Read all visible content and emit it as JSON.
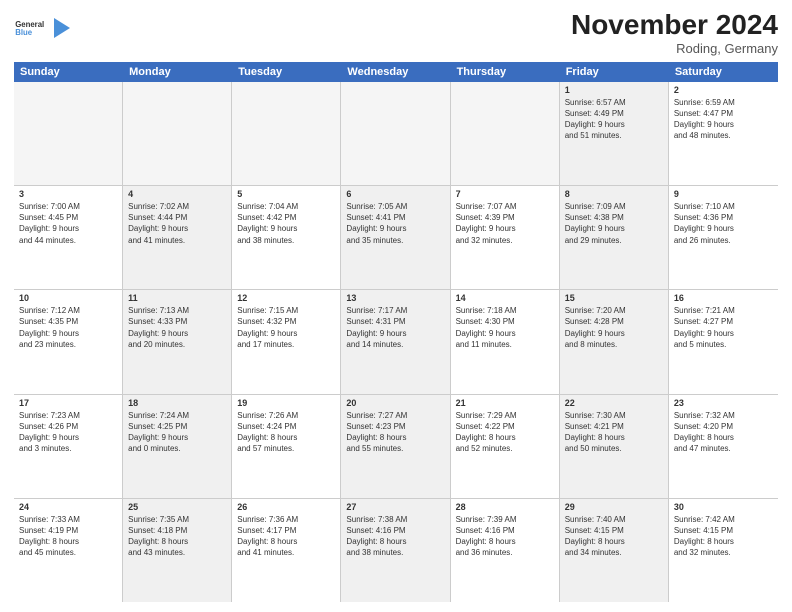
{
  "logo": {
    "line1": "General",
    "line2": "Blue"
  },
  "title": "November 2024",
  "location": "Roding, Germany",
  "header": {
    "days": [
      "Sunday",
      "Monday",
      "Tuesday",
      "Wednesday",
      "Thursday",
      "Friday",
      "Saturday"
    ]
  },
  "rows": [
    [
      {
        "day": "",
        "info": "",
        "empty": true
      },
      {
        "day": "",
        "info": "",
        "empty": true
      },
      {
        "day": "",
        "info": "",
        "empty": true
      },
      {
        "day": "",
        "info": "",
        "empty": true
      },
      {
        "day": "",
        "info": "",
        "empty": true
      },
      {
        "day": "1",
        "info": "Sunrise: 6:57 AM\nSunset: 4:49 PM\nDaylight: 9 hours\nand 51 minutes."
      },
      {
        "day": "2",
        "info": "Sunrise: 6:59 AM\nSunset: 4:47 PM\nDaylight: 9 hours\nand 48 minutes."
      }
    ],
    [
      {
        "day": "3",
        "info": "Sunrise: 7:00 AM\nSunset: 4:45 PM\nDaylight: 9 hours\nand 44 minutes."
      },
      {
        "day": "4",
        "info": "Sunrise: 7:02 AM\nSunset: 4:44 PM\nDaylight: 9 hours\nand 41 minutes."
      },
      {
        "day": "5",
        "info": "Sunrise: 7:04 AM\nSunset: 4:42 PM\nDaylight: 9 hours\nand 38 minutes."
      },
      {
        "day": "6",
        "info": "Sunrise: 7:05 AM\nSunset: 4:41 PM\nDaylight: 9 hours\nand 35 minutes."
      },
      {
        "day": "7",
        "info": "Sunrise: 7:07 AM\nSunset: 4:39 PM\nDaylight: 9 hours\nand 32 minutes."
      },
      {
        "day": "8",
        "info": "Sunrise: 7:09 AM\nSunset: 4:38 PM\nDaylight: 9 hours\nand 29 minutes."
      },
      {
        "day": "9",
        "info": "Sunrise: 7:10 AM\nSunset: 4:36 PM\nDaylight: 9 hours\nand 26 minutes."
      }
    ],
    [
      {
        "day": "10",
        "info": "Sunrise: 7:12 AM\nSunset: 4:35 PM\nDaylight: 9 hours\nand 23 minutes."
      },
      {
        "day": "11",
        "info": "Sunrise: 7:13 AM\nSunset: 4:33 PM\nDaylight: 9 hours\nand 20 minutes."
      },
      {
        "day": "12",
        "info": "Sunrise: 7:15 AM\nSunset: 4:32 PM\nDaylight: 9 hours\nand 17 minutes."
      },
      {
        "day": "13",
        "info": "Sunrise: 7:17 AM\nSunset: 4:31 PM\nDaylight: 9 hours\nand 14 minutes."
      },
      {
        "day": "14",
        "info": "Sunrise: 7:18 AM\nSunset: 4:30 PM\nDaylight: 9 hours\nand 11 minutes."
      },
      {
        "day": "15",
        "info": "Sunrise: 7:20 AM\nSunset: 4:28 PM\nDaylight: 9 hours\nand 8 minutes."
      },
      {
        "day": "16",
        "info": "Sunrise: 7:21 AM\nSunset: 4:27 PM\nDaylight: 9 hours\nand 5 minutes."
      }
    ],
    [
      {
        "day": "17",
        "info": "Sunrise: 7:23 AM\nSunset: 4:26 PM\nDaylight: 9 hours\nand 3 minutes."
      },
      {
        "day": "18",
        "info": "Sunrise: 7:24 AM\nSunset: 4:25 PM\nDaylight: 9 hours\nand 0 minutes."
      },
      {
        "day": "19",
        "info": "Sunrise: 7:26 AM\nSunset: 4:24 PM\nDaylight: 8 hours\nand 57 minutes."
      },
      {
        "day": "20",
        "info": "Sunrise: 7:27 AM\nSunset: 4:23 PM\nDaylight: 8 hours\nand 55 minutes."
      },
      {
        "day": "21",
        "info": "Sunrise: 7:29 AM\nSunset: 4:22 PM\nDaylight: 8 hours\nand 52 minutes."
      },
      {
        "day": "22",
        "info": "Sunrise: 7:30 AM\nSunset: 4:21 PM\nDaylight: 8 hours\nand 50 minutes."
      },
      {
        "day": "23",
        "info": "Sunrise: 7:32 AM\nSunset: 4:20 PM\nDaylight: 8 hours\nand 47 minutes."
      }
    ],
    [
      {
        "day": "24",
        "info": "Sunrise: 7:33 AM\nSunset: 4:19 PM\nDaylight: 8 hours\nand 45 minutes."
      },
      {
        "day": "25",
        "info": "Sunrise: 7:35 AM\nSunset: 4:18 PM\nDaylight: 8 hours\nand 43 minutes."
      },
      {
        "day": "26",
        "info": "Sunrise: 7:36 AM\nSunset: 4:17 PM\nDaylight: 8 hours\nand 41 minutes."
      },
      {
        "day": "27",
        "info": "Sunrise: 7:38 AM\nSunset: 4:16 PM\nDaylight: 8 hours\nand 38 minutes."
      },
      {
        "day": "28",
        "info": "Sunrise: 7:39 AM\nSunset: 4:16 PM\nDaylight: 8 hours\nand 36 minutes."
      },
      {
        "day": "29",
        "info": "Sunrise: 7:40 AM\nSunset: 4:15 PM\nDaylight: 8 hours\nand 34 minutes."
      },
      {
        "day": "30",
        "info": "Sunrise: 7:42 AM\nSunset: 4:15 PM\nDaylight: 8 hours\nand 32 minutes."
      }
    ]
  ]
}
